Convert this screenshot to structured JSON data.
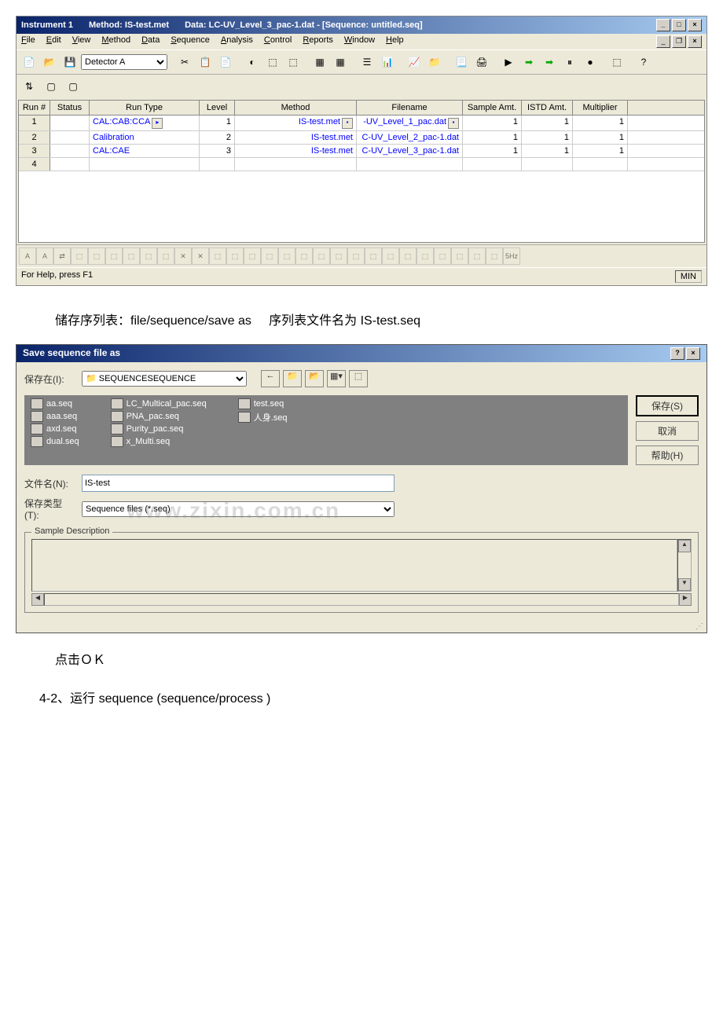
{
  "app_window": {
    "title_instrument": "Instrument 1",
    "title_method": "Method: IS-test.met",
    "title_data": "Data: LC-UV_Level_3_pac-1.dat - [Sequence: untitled.seq]",
    "menus": {
      "file": "File",
      "edit": "Edit",
      "view": "View",
      "method": "Method",
      "data": "Data",
      "sequence": "Sequence",
      "analysis": "Analysis",
      "control": "Control",
      "reports": "Reports",
      "window": "Window",
      "help": "Help"
    },
    "detector_label": "Detector A",
    "grid": {
      "headers": {
        "run": "Run #",
        "status": "Status",
        "runtype": "Run Type",
        "level": "Level",
        "method": "Method",
        "filename": "Filename",
        "sample": "Sample Amt.",
        "istd": "ISTD Amt.",
        "mult": "Multiplier"
      },
      "rows": [
        {
          "run": "1",
          "status": "",
          "runtype": "CAL:CAB:CCA",
          "level": "1",
          "method": "IS-test.met",
          "filename": "-UV_Level_1_pac.dat",
          "sample": "1",
          "istd": "1",
          "mult": "1"
        },
        {
          "run": "2",
          "status": "",
          "runtype": "Calibration",
          "level": "2",
          "method": "IS-test.met",
          "filename": "C-UV_Level_2_pac-1.dat",
          "sample": "1",
          "istd": "1",
          "mult": "1"
        },
        {
          "run": "3",
          "status": "",
          "runtype": "CAL:CAE",
          "level": "3",
          "method": "IS-test.met",
          "filename": "C-UV_Level_3_pac-1.dat",
          "sample": "1",
          "istd": "1",
          "mult": "1"
        },
        {
          "run": "4",
          "status": "",
          "runtype": "",
          "level": "",
          "method": "",
          "filename": "",
          "sample": "",
          "istd": "",
          "mult": ""
        }
      ]
    },
    "status_text": "For Help, press F1",
    "status_right": "MIN"
  },
  "text1": "储存序列表：file/sequence/save as",
  "text1b": "序列表文件名为 IS-test.seq",
  "dialog": {
    "title": "Save sequence file as",
    "save_in_label": "保存在(I):",
    "folder": "SEQUENCE",
    "files_col1": [
      "aa.seq",
      "aaa.seq",
      "axd.seq",
      "dual.seq"
    ],
    "files_col2": [
      "LC_Multical_pac.seq",
      "PNA_pac.seq",
      "Purity_pac.seq",
      "x_Multi.seq"
    ],
    "files_col3": [
      "test.seq",
      "人身.seq"
    ],
    "btn_save": "保存(S)",
    "btn_cancel": "取消",
    "btn_help": "帮助(H)",
    "filename_label": "文件名(N):",
    "filename_value": "IS-test",
    "filetype_label": "保存类型(T):",
    "filetype_value": "Sequence files (*.seq)",
    "sample_desc_label": "Sample Description"
  },
  "watermark": "www.zixin.com.cn",
  "text2": "点击ＯＫ",
  "text3": "4-2、运行 sequence (sequence/process )"
}
